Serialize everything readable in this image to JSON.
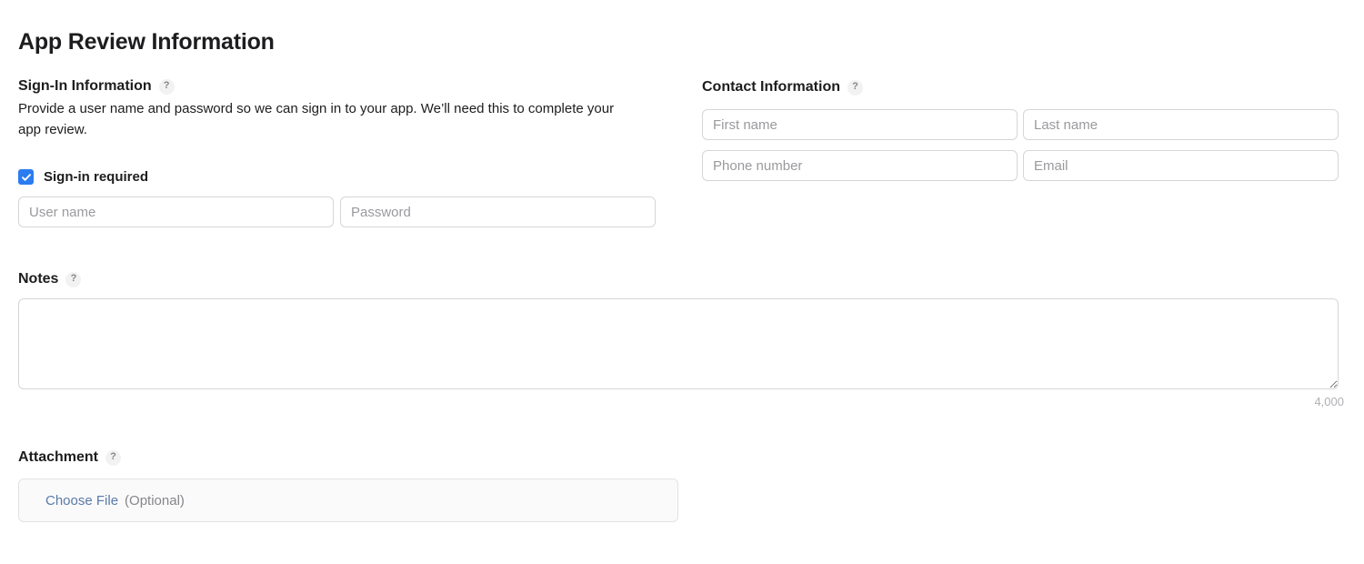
{
  "page": {
    "title": "App Review Information"
  },
  "signin": {
    "heading": "Sign-In Information",
    "help_icon": "?",
    "description": "Provide a user name and password so we can sign in to your app. We’ll need this to complete your app review.",
    "checkbox_label": "Sign-in required",
    "checkbox_checked": true,
    "username_placeholder": "User name",
    "username_value": "",
    "password_placeholder": "Password",
    "password_value": ""
  },
  "contact": {
    "heading": "Contact Information",
    "help_icon": "?",
    "first_name_placeholder": "First name",
    "first_name_value": "",
    "last_name_placeholder": "Last name",
    "last_name_value": "",
    "phone_placeholder": "Phone number",
    "phone_value": "",
    "email_placeholder": "Email",
    "email_value": ""
  },
  "notes": {
    "heading": "Notes",
    "help_icon": "?",
    "value": "",
    "placeholder": "",
    "counter": "4,000"
  },
  "attachment": {
    "heading": "Attachment",
    "help_icon": "?",
    "choose_file_label": "Choose File",
    "optional_label": "(Optional)"
  },
  "colors": {
    "accent_checkbox": "#2b7cf0",
    "link_blue": "#5a7aa8",
    "text_primary": "#1d1d1f",
    "text_secondary": "#86868b",
    "placeholder": "#9a9a9e",
    "border": "#d6d6d8",
    "attachment_fill": "#fafafa",
    "help_badge_bg": "#f2f2f3"
  }
}
